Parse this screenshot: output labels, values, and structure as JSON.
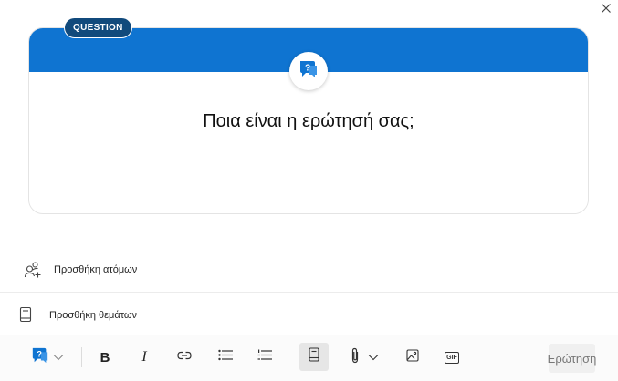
{
  "dialog": {
    "close_icon": "close-icon"
  },
  "card": {
    "badge": "QUESTION",
    "header_color": "#0f74d1",
    "icon": "question-chat-icon",
    "title": "Ποια είναι η ερώτησή σας;"
  },
  "people": {
    "icon": "add-people-icon",
    "label": "Προσθήκη ατόμων"
  },
  "topics": {
    "icon": "topic-book-icon",
    "label": "Προσθήκη θεμάτων"
  },
  "toolbar": {
    "post_type_icon": "question-chat-icon",
    "bold": "B",
    "italic": "I",
    "gif": "GIF",
    "submit_label": "Ερώτηση"
  },
  "colors": {
    "accent": "#0f74d1",
    "badge": "#114a7c"
  }
}
